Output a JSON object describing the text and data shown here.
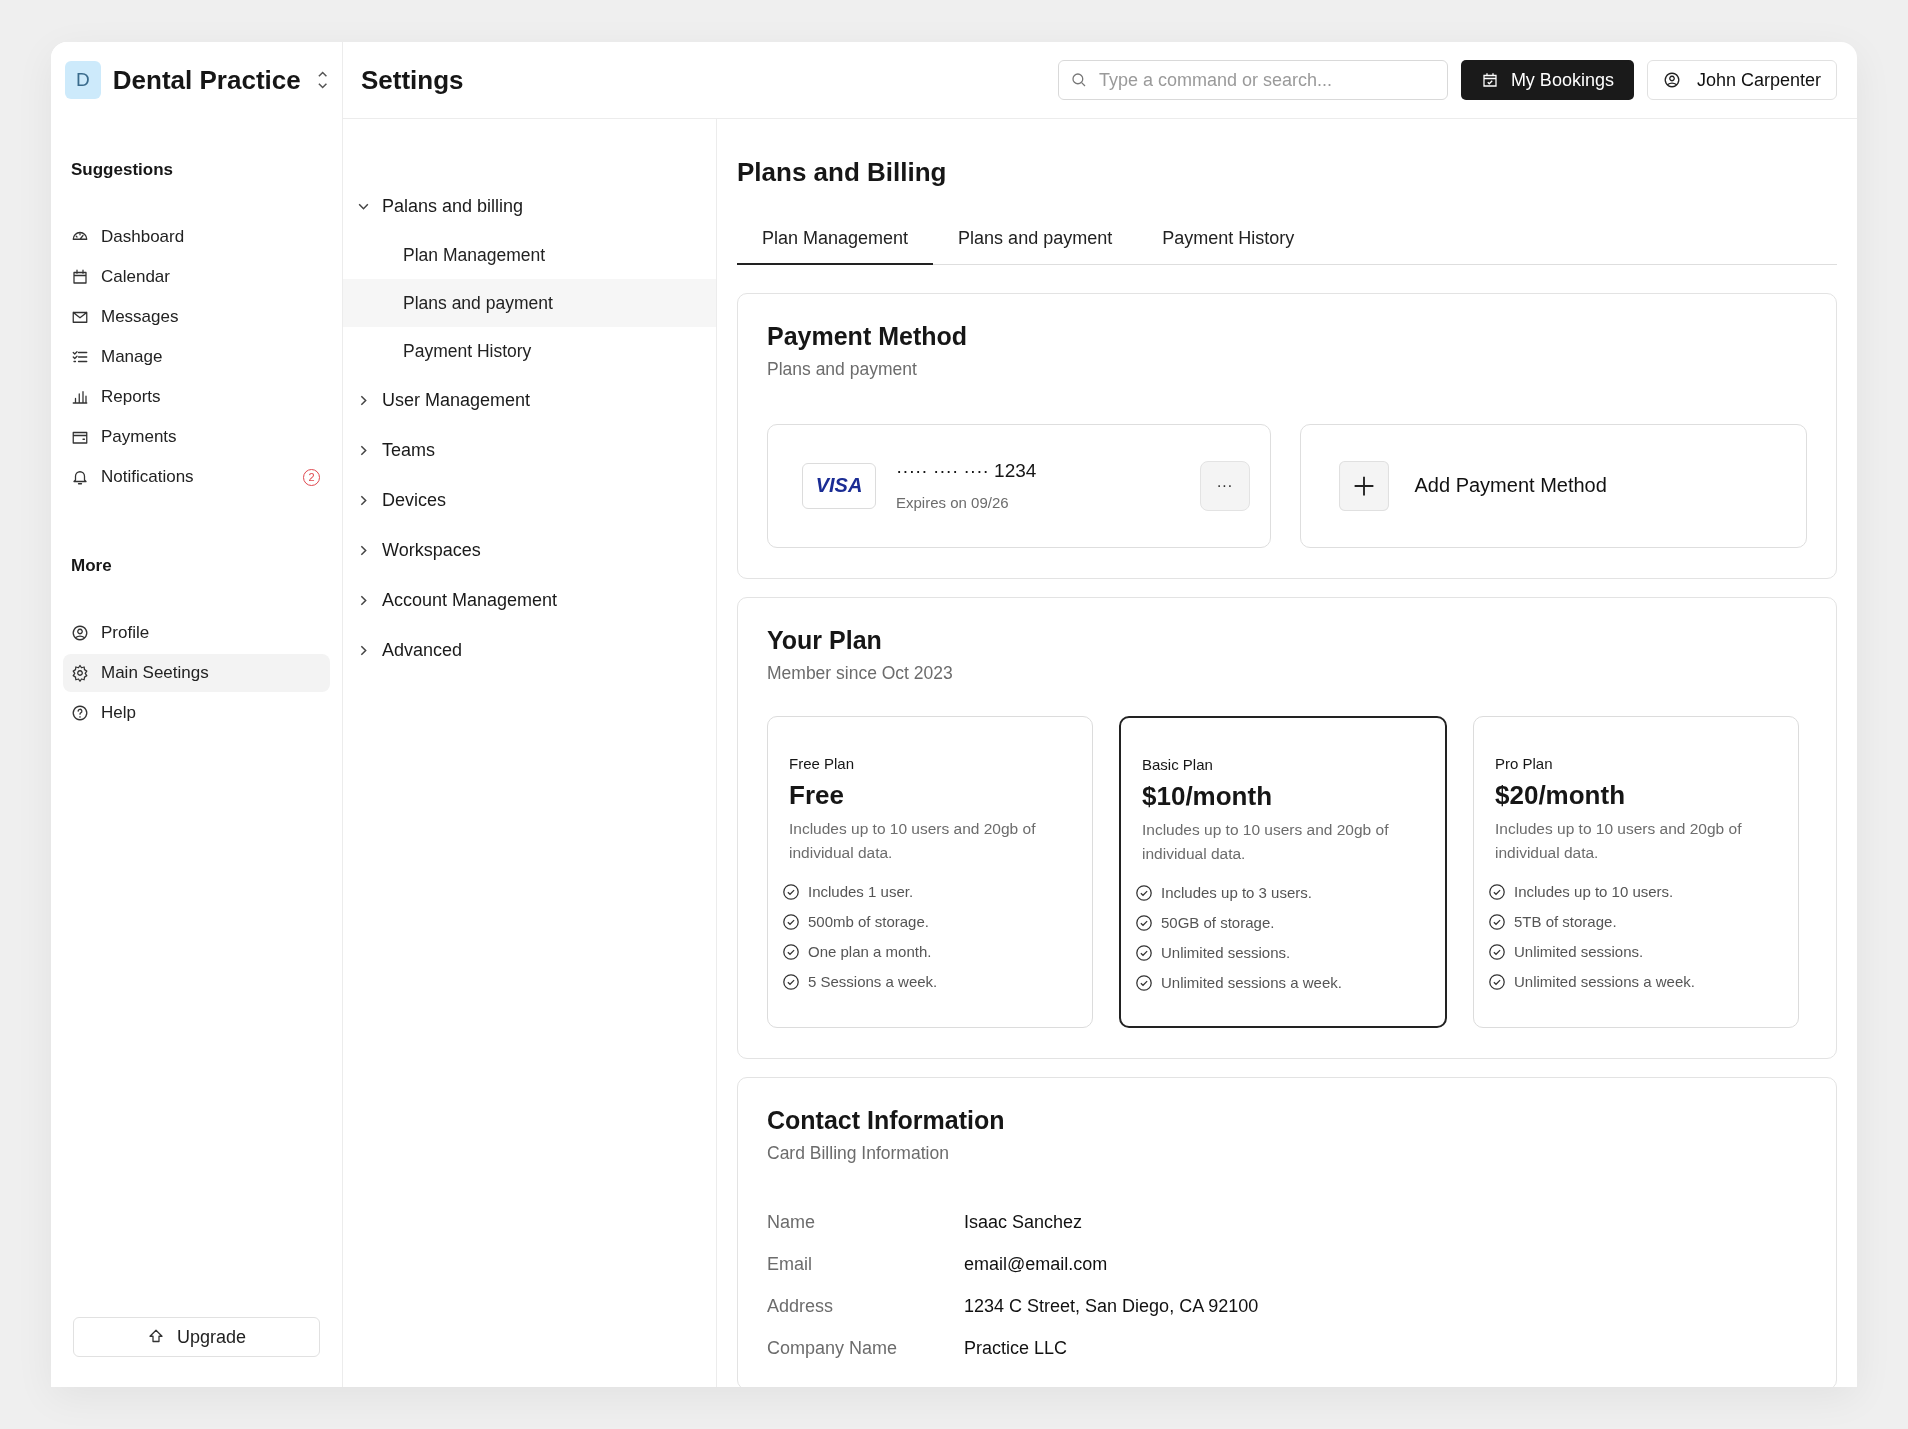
{
  "workspace": {
    "initial": "D",
    "name": "Dental Practice"
  },
  "sidebar": {
    "sections": [
      {
        "title": "Suggestions",
        "items": [
          {
            "label": "Dashboard",
            "selected": false
          },
          {
            "label": "Calendar",
            "selected": false
          },
          {
            "label": "Messages",
            "selected": false
          },
          {
            "label": "Manage",
            "selected": false
          },
          {
            "label": "Reports",
            "selected": false
          },
          {
            "label": "Payments",
            "selected": false
          },
          {
            "label": "Notifications",
            "selected": false,
            "badge": "2"
          }
        ]
      },
      {
        "title": "More",
        "items": [
          {
            "label": "Profile",
            "selected": false
          },
          {
            "label": "Main Seetings",
            "selected": true
          },
          {
            "label": "Help",
            "selected": false
          }
        ]
      }
    ],
    "upgrade_button": "Upgrade"
  },
  "header": {
    "title": "Settings",
    "search": {
      "placeholder": "Type a command or search..."
    },
    "bookings_button": "My Bookings",
    "user_button": "John Carpenter"
  },
  "settings_tree": [
    {
      "label": "Palans and billing",
      "expanded": true,
      "children": [
        {
          "label": "Plan Management",
          "selected": false
        },
        {
          "label": "Plans and payment",
          "selected": true
        },
        {
          "label": "Payment History",
          "selected": false
        }
      ]
    },
    {
      "label": "User Management",
      "expanded": false
    },
    {
      "label": "Teams",
      "expanded": false
    },
    {
      "label": "Devices",
      "expanded": false
    },
    {
      "label": "Workspaces",
      "expanded": false
    },
    {
      "label": "Account Management",
      "expanded": false
    },
    {
      "label": "Advanced",
      "expanded": false
    }
  ],
  "page": {
    "title": "Plans and Billing",
    "tabs": [
      {
        "label": "Plan Management",
        "selected": true
      },
      {
        "label": "Plans and payment",
        "selected": false
      },
      {
        "label": "Payment History",
        "selected": false
      }
    ],
    "payment_method": {
      "title": "Payment Method",
      "subtitle": "Plans and payment",
      "card": {
        "brand": "VISA",
        "number": "····· ···· ···· 1234",
        "expiry": "Expires on 09/26",
        "menu": "···"
      },
      "add_button": "Add Payment Method"
    },
    "your_plan": {
      "title": "Your Plan",
      "subtitle": "Member since Oct 2023",
      "plans": [
        {
          "name": "Free Plan",
          "price": "Free",
          "description": "Includes up to 10 users and 20gb of individual data.",
          "selected": false,
          "features": [
            "Includes 1 user.",
            "500mb of storage.",
            "One plan a month.",
            "5 Sessions a week."
          ]
        },
        {
          "name": "Basic Plan",
          "price": "$10/month",
          "description": "Includes up to 10 users and 20gb of individual data.",
          "selected": true,
          "features": [
            "Includes up to 3 users.",
            "50GB of storage.",
            "Unlimited sessions.",
            "Unlimited sessions a week."
          ]
        },
        {
          "name": "Pro Plan",
          "price": "$20/month",
          "description": "Includes up to 10 users and 20gb of individual data.",
          "selected": false,
          "features": [
            "Includes up to 10 users.",
            "5TB of storage.",
            "Unlimited sessions.",
            "Unlimited sessions a week."
          ]
        }
      ]
    },
    "contact": {
      "title": "Contact Information",
      "subtitle": "Card Billing Information",
      "fields": [
        {
          "label": "Name",
          "value": "Isaac Sanchez"
        },
        {
          "label": "Email",
          "value": "email@email.com"
        },
        {
          "label": "Address",
          "value": "1234 C Street, San Diego, CA 92100"
        },
        {
          "label": "Company Name",
          "value": "Practice LLC"
        }
      ]
    }
  }
}
